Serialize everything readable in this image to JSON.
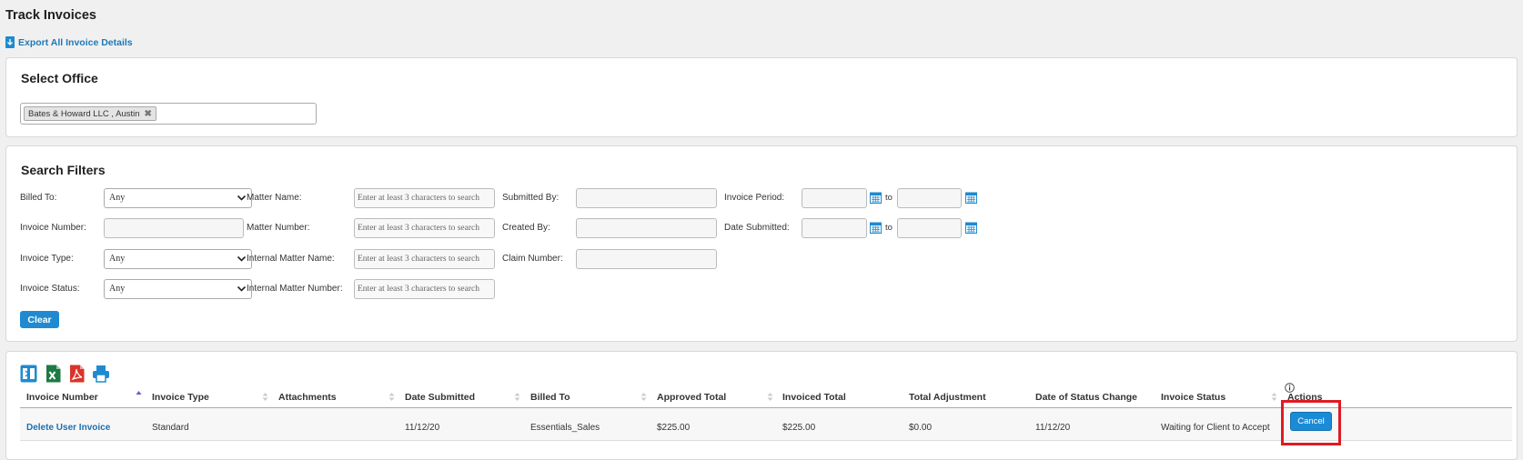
{
  "page": {
    "title": "Track Invoices"
  },
  "export": {
    "label": "Export All Invoice Details",
    "icon": "export-icon"
  },
  "office": {
    "heading": "Select Office",
    "selected": [
      {
        "label": "Bates & Howard LLC , Austin"
      }
    ],
    "remove_glyph": "✖"
  },
  "filters": {
    "heading": "Search Filters",
    "billed_to": {
      "label": "Billed To:",
      "value": "Any"
    },
    "invoice_number": {
      "label": "Invoice Number:",
      "value": ""
    },
    "invoice_type": {
      "label": "Invoice Type:",
      "value": "Any"
    },
    "invoice_status": {
      "label": "Invoice Status:",
      "value": "Any"
    },
    "matter_name": {
      "label": "Matter Name:",
      "placeholder": "Enter at least 3 characters to search"
    },
    "matter_number": {
      "label": "Matter Number:",
      "placeholder": "Enter at least 3 characters to search"
    },
    "internal_matter_name": {
      "label": "Internal Matter Name:",
      "placeholder": "Enter at least 3 characters to search"
    },
    "internal_matter_number": {
      "label": "Internal Matter Number:",
      "placeholder": "Enter at least 3 characters to search"
    },
    "submitted_by": {
      "label": "Submitted By:",
      "value": ""
    },
    "created_by": {
      "label": "Created By:",
      "value": ""
    },
    "claim_number": {
      "label": "Claim Number:",
      "value": ""
    },
    "invoice_period": {
      "label": "Invoice Period:",
      "from": "",
      "to": ""
    },
    "date_submitted": {
      "label": "Date Submitted:",
      "from": "",
      "to": ""
    },
    "to_label": "to",
    "clear_label": "Clear"
  },
  "toolbar": {
    "icons": [
      "column-chooser-icon",
      "excel-export-icon",
      "pdf-export-icon",
      "print-icon"
    ]
  },
  "table": {
    "columns": [
      {
        "label": "Invoice Number",
        "sort": "asc"
      },
      {
        "label": "Invoice Type",
        "sort": "none"
      },
      {
        "label": "Attachments",
        "sort": "none"
      },
      {
        "label": "Date Submitted",
        "sort": "none"
      },
      {
        "label": "Billed To",
        "sort": "none"
      },
      {
        "label": "Approved Total",
        "sort": "none"
      },
      {
        "label": "Invoiced Total",
        "sort": "none"
      },
      {
        "label": "Total Adjustment",
        "sort": "none"
      },
      {
        "label": "Date of Status Change",
        "sort": "none"
      },
      {
        "label": "Invoice Status",
        "sort": "none"
      },
      {
        "label": "Actions",
        "sort": "none"
      }
    ],
    "rows": [
      {
        "invoice_number": "Delete User Invoice",
        "invoice_type": "Standard",
        "attachments": "",
        "date_submitted": "11/12/20",
        "billed_to": "Essentials_Sales",
        "approved_total": "$225.00",
        "invoiced_total": "$225.00",
        "total_adjustment": "$0.00",
        "date_of_status_change": "11/12/20",
        "invoice_status": "Waiting for Client to Accept",
        "action_label": "Cancel"
      }
    ]
  },
  "colors": {
    "accent": "#1f8ad0",
    "link": "#1d6fb0",
    "highlight": "#e01a22",
    "excel": "#1e7a45",
    "pdf": "#d9342b"
  }
}
